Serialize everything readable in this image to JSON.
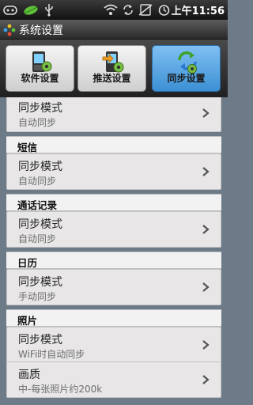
{
  "status_bar": {
    "time": "上午11:56",
    "icons": [
      "game-icon",
      "leaf-icon",
      "usb-icon",
      "wifi-icon",
      "sync-icon",
      "no-sim-icon",
      "alarm-icon"
    ]
  },
  "app": {
    "title": "系统设置",
    "logo_icon": "app-logo-icon"
  },
  "tabs": [
    {
      "label": "软件设置",
      "icon": "phone-gear-icon",
      "active": false
    },
    {
      "label": "推送设置",
      "icon": "phone-arrow-gear-icon",
      "active": false
    },
    {
      "label": "同步设置",
      "icon": "sync-gear-icon",
      "active": true
    }
  ],
  "sections": [
    {
      "title": "",
      "items": [
        {
          "title": "同步模式",
          "subtitle": "自动同步"
        }
      ]
    },
    {
      "title": "短信",
      "items": [
        {
          "title": "同步模式",
          "subtitle": "自动同步"
        }
      ]
    },
    {
      "title": "通话记录",
      "items": [
        {
          "title": "同步模式",
          "subtitle": "自动同步"
        }
      ]
    },
    {
      "title": "日历",
      "items": [
        {
          "title": "同步模式",
          "subtitle": "手动同步"
        }
      ]
    },
    {
      "title": "照片",
      "items": [
        {
          "title": "同步模式",
          "subtitle": "WiFi时自动同步"
        },
        {
          "title": "画质",
          "subtitle": "中-每张照片约200k"
        }
      ]
    }
  ],
  "colors": {
    "active_tab": "#4a9ee0",
    "background": "#6d7b88"
  }
}
